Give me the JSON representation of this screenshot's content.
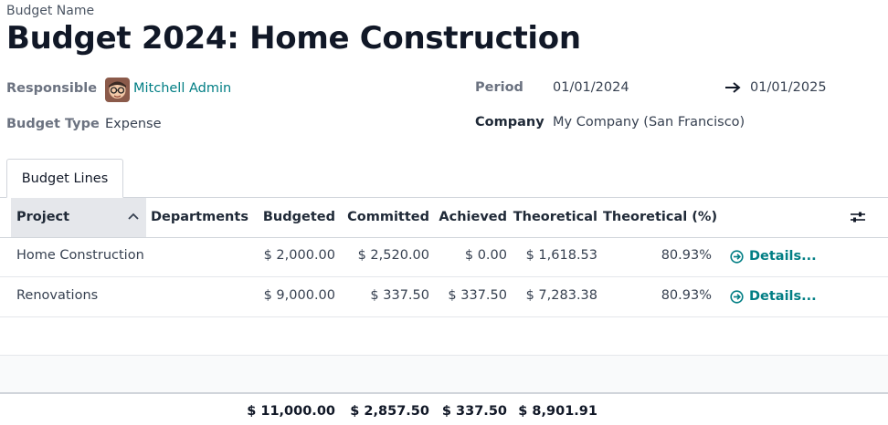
{
  "form": {
    "name_label": "Budget Name",
    "title": "Budget 2024: Home Construction",
    "responsible_label": "Responsible",
    "responsible_value": "Mitchell Admin",
    "budget_type_label": "Budget Type",
    "budget_type_value": "Expense",
    "period_label": "Period",
    "period_start": "01/01/2024",
    "period_end": "01/01/2025",
    "company_label": "Company",
    "company_value": "My Company (San Francisco)"
  },
  "tabs": [
    {
      "label": "Budget Lines"
    }
  ],
  "table": {
    "columns": [
      "Project",
      "Departments",
      "Budgeted",
      "Committed",
      "Achieved",
      "Theoretical",
      "Theoretical (%)"
    ],
    "rows": [
      {
        "project": "Home Construction",
        "department": "",
        "budgeted": "$ 2,000.00",
        "committed": "$ 2,520.00",
        "achieved": "$ 0.00",
        "theoretical": "$ 1,618.53",
        "theoretical_pct": "80.93%",
        "action": "Details..."
      },
      {
        "project": "Renovations",
        "department": "",
        "budgeted": "$ 9,000.00",
        "committed": "$ 337.50",
        "achieved": "$ 337.50",
        "theoretical": "$ 7,283.38",
        "theoretical_pct": "80.93%",
        "action": "Details..."
      }
    ],
    "totals": {
      "budgeted": "$ 11,000.00",
      "committed": "$ 2,857.50",
      "achieved": "$ 337.50",
      "theoretical": "$ 8,901.91"
    }
  },
  "colors": {
    "accent": "#017e84",
    "header_sorted_bg": "#e5e7eb"
  },
  "icons": [
    "arrow-right-icon",
    "sort-up-icon",
    "column-settings-icon",
    "arrow-circle-right-icon"
  ]
}
